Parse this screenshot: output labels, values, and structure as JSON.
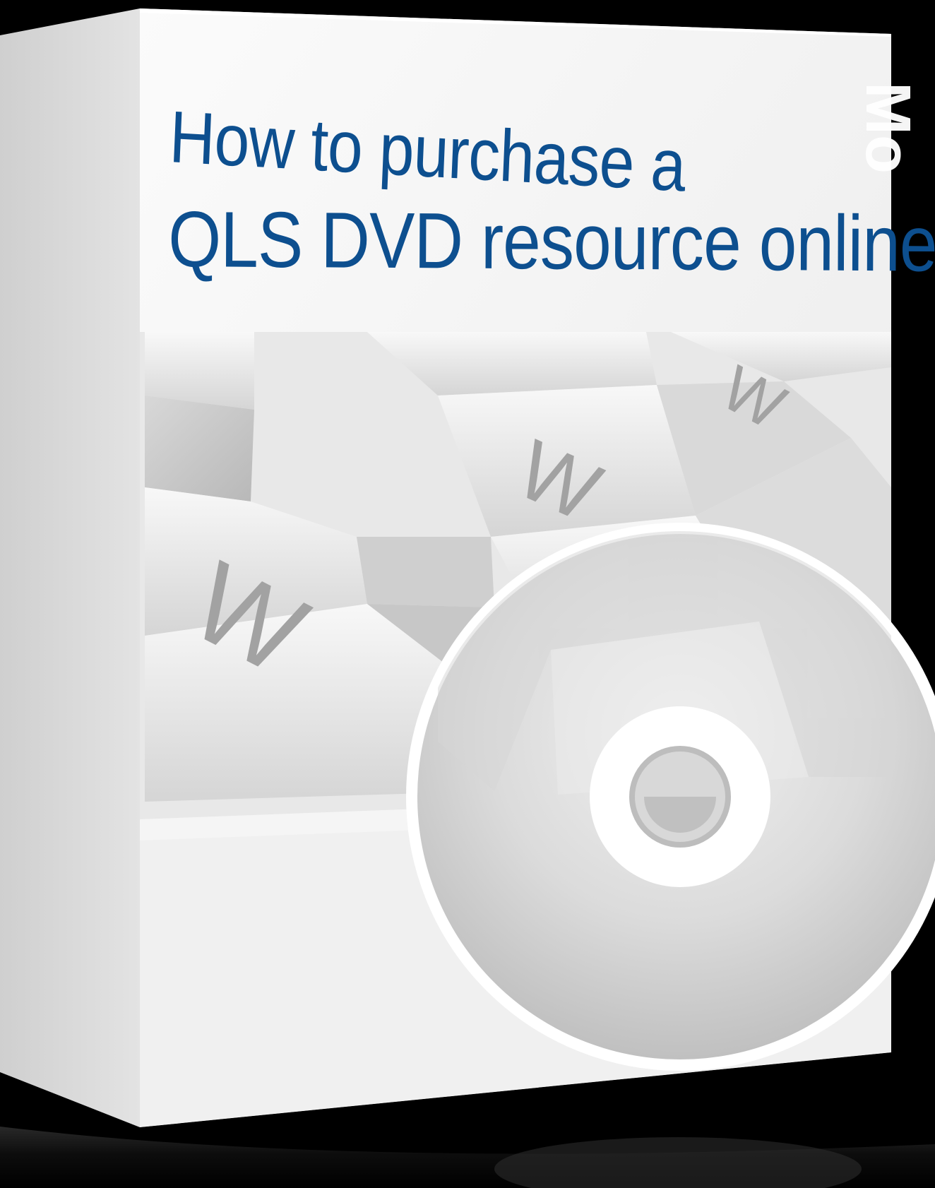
{
  "cover": {
    "title_line_1": "How to purchase a",
    "title_line_2": "QLS DVD resource online",
    "keyboard_key_letter": "W",
    "side_text": "Mo"
  },
  "colors": {
    "background": "#000000",
    "title": "#0d4f8f",
    "box_face": "#f4f4f4",
    "box_shadow": "#d7d7d7",
    "disc": "#cfcfcf",
    "disc_rim": "#ffffff",
    "key_letter": "#9f9f9f"
  }
}
